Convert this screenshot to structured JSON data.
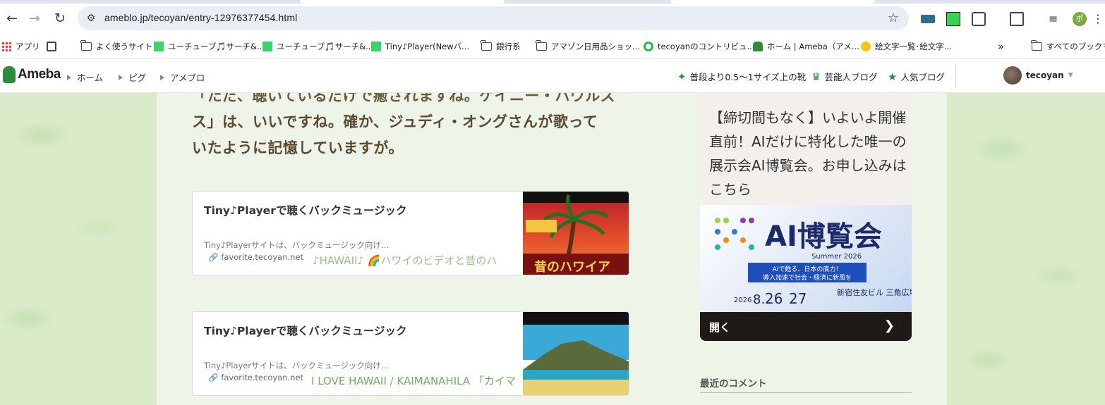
{
  "browser": {
    "url": "ameblo.jp/tecoyan/entry-12976377454.html",
    "bookmarks": [
      {
        "label": "アプリ",
        "icon": "apps-grid-icon"
      },
      {
        "label": "",
        "icon": "tab-groups-icon"
      },
      {
        "label": "よく使うサイト",
        "icon": "folder-icon"
      },
      {
        "label": "ユーチューブ🎵サーチ&...",
        "icon": "site-icon"
      },
      {
        "label": "ユーチューブ🎵サーチ&...",
        "icon": "site-icon"
      },
      {
        "label": "Tiny♪Player(Newバ...",
        "icon": "site-icon"
      },
      {
        "label": "銀行系",
        "icon": "folder-icon"
      },
      {
        "label": "アマゾン日用品ショッ...",
        "icon": "folder-icon"
      },
      {
        "label": "tecoyanのコントリビュ...",
        "icon": "site-icon"
      },
      {
        "label": "ホーム | Ameba（アメ...",
        "icon": "ameba-icon"
      },
      {
        "label": "絵文字一覧･絵文字...",
        "icon": "emoji-icon"
      }
    ],
    "all_bookmarks": "すべてのブックマー",
    "more": "»"
  },
  "header": {
    "logo": "Ameba",
    "crumbs": [
      "ホーム",
      "ピグ",
      "アメブロ"
    ],
    "links": [
      {
        "label": "普段より0.5〜1サイズ上の靴",
        "icon": "sparkle-icon"
      },
      {
        "label": "芸能人ブログ",
        "icon": "crown-icon"
      },
      {
        "label": "人気ブログ",
        "icon": "star-icon"
      }
    ],
    "user": "tecoyan"
  },
  "article": {
    "line1": "「ただ、聴いているだけで癒されますね。ケイニー・ハウルズ",
    "line2": "ス」は、いいですね。確か、ジュディ・オングさんが歌って",
    "line3": "いたように記憶していますが。"
  },
  "cards": [
    {
      "title": "Tiny♪Playerで聴くバックミュージック",
      "desc": "Tiny♪Playerサイトは、バックミュージック向け…",
      "host": "favorite.tecoyan.net",
      "overlay": "♪HAWAII♪ 🌈ハワイのビデオと昔のハ",
      "image_text": "昔のハワイア"
    },
    {
      "title": "Tiny♪Playerで聴くバックミュージック",
      "desc": "Tiny♪Playerサイトは、バックミュージック向け…",
      "host": "favorite.tecoyan.net",
      "overlay": "I LOVE HAWAII / KAIMANAHILA 「カイマ"
    }
  ],
  "sidebar": {
    "promo": "【締切間もなく】いよいよ開催直前！AIだけに特化した唯一の展示会AI博覧会。お申し込みはこちら",
    "ad": {
      "title": "AI博覧会",
      "sub": "Summer 2026",
      "tag1": "AIで甦る、日本の底力！",
      "tag2": "導入加速で社会・経済に新風を",
      "date_prefix": "2026",
      "date_month": "8.",
      "day1": "26",
      "day2": "27",
      "venue": "新宿住友ビル 三角広場",
      "button": "開く"
    },
    "recent": "最近のコメント"
  }
}
